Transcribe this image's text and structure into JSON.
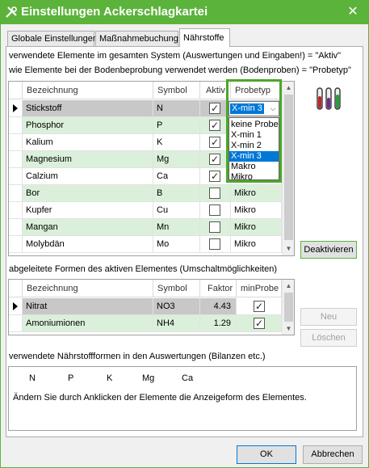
{
  "window": {
    "title": "Einstellungen Ackerschlagkartei",
    "close": "✕"
  },
  "tabs": [
    "Globale Einstellungen",
    "Maßnahmebuchung",
    "Nährstoffe"
  ],
  "info_line1": "verwendete Elemente im gesamten System (Auswertungen und Eingaben!) = \"Aktiv\"",
  "info_line2": "wie Elemente bei der Bodenbeprobung verwendet werden (Bodenproben) = \"Probetyp\"",
  "elements_grid": {
    "headers": [
      "Bezeichnung",
      "Symbol",
      "Aktiv",
      "Probetyp"
    ],
    "rows": [
      {
        "name": "Stickstoff",
        "symbol": "N",
        "active": true,
        "type": "X-min 3"
      },
      {
        "name": "Phosphor",
        "symbol": "P",
        "active": true,
        "type": ""
      },
      {
        "name": "Kalium",
        "symbol": "K",
        "active": true,
        "type": ""
      },
      {
        "name": "Magnesium",
        "symbol": "Mg",
        "active": true,
        "type": ""
      },
      {
        "name": "Calzium",
        "symbol": "Ca",
        "active": true,
        "type": ""
      },
      {
        "name": "Bor",
        "symbol": "B",
        "active": false,
        "type": "Mikro"
      },
      {
        "name": "Kupfer",
        "symbol": "Cu",
        "active": false,
        "type": "Mikro"
      },
      {
        "name": "Mangan",
        "symbol": "Mn",
        "active": false,
        "type": "Mikro"
      },
      {
        "name": "Molybdän",
        "symbol": "Mo",
        "active": false,
        "type": "Mikro"
      }
    ]
  },
  "probetyp_combo": {
    "value": "X-min 3",
    "options": [
      "keine Probe",
      "X-min 1",
      "X-min 2",
      "X-min 3",
      "Makro",
      "Mikro"
    ],
    "selected": "X-min 3"
  },
  "deactivate_label": "Deaktivieren",
  "derived_label": "abgeleitete Formen des aktiven Elementes (Umschaltmöglichkeiten)",
  "derived_grid": {
    "headers": [
      "Bezeichnung",
      "Symbol",
      "Faktor",
      "minProbe"
    ],
    "rows": [
      {
        "name": "Nitrat",
        "symbol": "NO3",
        "factor": "4.43",
        "minprobe": true
      },
      {
        "name": "Amoniumionen",
        "symbol": "NH4",
        "factor": "1.29",
        "minprobe": true
      }
    ]
  },
  "new_label": "Neu",
  "delete_label": "Löschen",
  "forms_label": "verwendete Nährstoffformen in den Auswertungen (Bilanzen etc.)",
  "forms_items": [
    "N",
    "P",
    "K",
    "Mg",
    "Ca"
  ],
  "forms_hint": "Ändern Sie durch Anklicken der Elemente die Anzeigeform des Elementes.",
  "ok_label": "OK",
  "cancel_label": "Abbrechen",
  "colors": {
    "accent": "#5cb33b",
    "row_green": "#dbf0da",
    "selection": "#0078d7"
  }
}
